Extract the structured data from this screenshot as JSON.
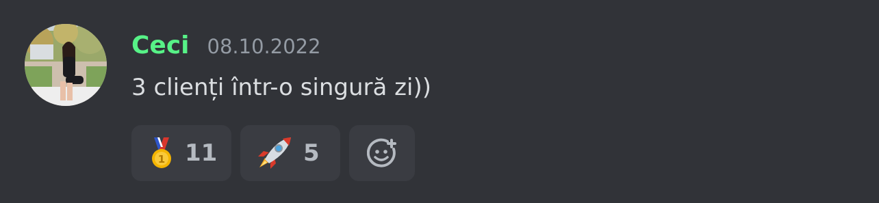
{
  "message": {
    "author": "Ceci",
    "timestamp": "08.10.2022",
    "text": "3 clienți într-o singură zi))",
    "author_color": "#57f287"
  },
  "reactions": [
    {
      "emoji": "1st-place-medal",
      "count": "11"
    },
    {
      "emoji": "rocket",
      "count": "5"
    }
  ],
  "add_reaction": {
    "icon": "add-reaction-icon"
  }
}
